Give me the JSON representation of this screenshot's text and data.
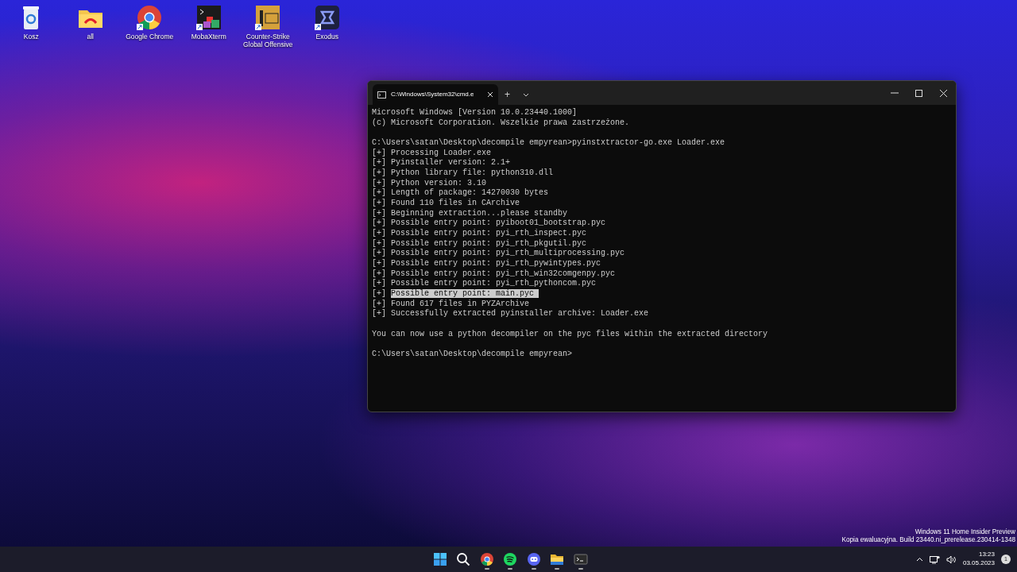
{
  "desktop_icons": [
    {
      "kind": "recycle",
      "label": "Kosz",
      "shortcut": false
    },
    {
      "kind": "folder",
      "label": "all",
      "shortcut": false
    },
    {
      "kind": "chrome",
      "label": "Google Chrome",
      "shortcut": true
    },
    {
      "kind": "moba",
      "label": "MobaXterm",
      "shortcut": true
    },
    {
      "kind": "csgo",
      "label": "Counter-Strike Global Offensive",
      "shortcut": true
    },
    {
      "kind": "exodus",
      "label": "Exodus",
      "shortcut": true
    }
  ],
  "terminal": {
    "tab_title": "C:\\Windows\\System32\\cmd.e",
    "new_tab": "+",
    "blocks": [
      [
        {
          "text": "Microsoft Windows [Version 10.0.23440.1000]"
        },
        {
          "text": "(c) Microsoft Corporation. Wszelkie prawa zastrzeżone."
        }
      ],
      [
        {
          "text": "C:\\Users\\satan\\Desktop\\decompile empyrean>pyinstxtractor-go.exe Loader.exe"
        },
        {
          "text": "[+] Processing Loader.exe"
        },
        {
          "text": "[+] Pyinstaller version: 2.1+"
        },
        {
          "text": "[+] Python library file: python310.dll"
        },
        {
          "text": "[+] Python version: 3.10"
        },
        {
          "text": "[+] Length of package: 14270030 bytes"
        },
        {
          "text": "[+] Found 110 files in CArchive"
        },
        {
          "text": "[+] Beginning extraction...please standby"
        },
        {
          "text": "[+] Possible entry point: pyiboot01_bootstrap.pyc"
        },
        {
          "text": "[+] Possible entry point: pyi_rth_inspect.pyc"
        },
        {
          "text": "[+] Possible entry point: pyi_rth_pkgutil.pyc"
        },
        {
          "text": "[+] Possible entry point: pyi_rth_multiprocessing.pyc"
        },
        {
          "text": "[+] Possible entry point: pyi_rth_pywintypes.pyc"
        },
        {
          "text": "[+] Possible entry point: pyi_rth_win32comgenpy.pyc"
        },
        {
          "text": "[+] Possible entry point: pyi_rth_pythoncom.pyc"
        },
        {
          "text": "[+]",
          "selection": "Possible entry point: main.pyc"
        },
        {
          "text": "[+] Found 617 files in PYZArchive"
        },
        {
          "text": "[+] Successfully extracted pyinstaller archive: Loader.exe"
        }
      ],
      [
        {
          "text": "You can now use a python decompiler on the pyc files within the extracted directory"
        }
      ],
      [
        {
          "text": "C:\\Users\\satan\\Desktop\\decompile empyrean>"
        }
      ]
    ]
  },
  "watermark_notice": [
    "Windows 11 Home Insider Preview",
    "Kopia ewaluacyjna. Build 23440.ni_prerelease.230414-1348"
  ],
  "taskbar": {
    "apps": [
      {
        "kind": "start",
        "running": false
      },
      {
        "kind": "search",
        "running": false
      },
      {
        "kind": "chrome",
        "running": true
      },
      {
        "kind": "spotify",
        "running": true
      },
      {
        "kind": "discord",
        "running": true
      },
      {
        "kind": "explorer",
        "running": true
      },
      {
        "kind": "terminal",
        "running": true
      }
    ],
    "time": "13:23",
    "date": "03.05.2023",
    "notifications": "1"
  }
}
